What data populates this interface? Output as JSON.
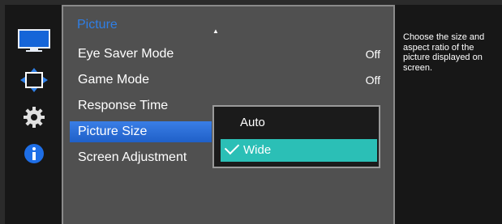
{
  "sidebar": {
    "icons": [
      "picture-icon",
      "onscreen-display-icon",
      "gear-icon",
      "info-icon"
    ]
  },
  "menu": {
    "title": "Picture",
    "scroll_indicator": "▲",
    "items": [
      {
        "label": "Eye Saver Mode",
        "value": "Off"
      },
      {
        "label": "Game Mode",
        "value": "Off"
      },
      {
        "label": "Response Time",
        "value": ""
      },
      {
        "label": "Picture Size",
        "value": ""
      },
      {
        "label": "Screen Adjustment",
        "value": ""
      }
    ],
    "active_item": "Picture Size"
  },
  "submenu": {
    "options": [
      "Auto",
      "Wide"
    ],
    "selected": "Wide"
  },
  "help": {
    "text": "Choose the size and aspect ratio of the picture displayed on screen."
  },
  "colors": {
    "accent_blue": "#2f7fe6",
    "selected_teal": "#2bbfb6",
    "panel_gray": "#505050",
    "dark_panel": "#171717"
  }
}
